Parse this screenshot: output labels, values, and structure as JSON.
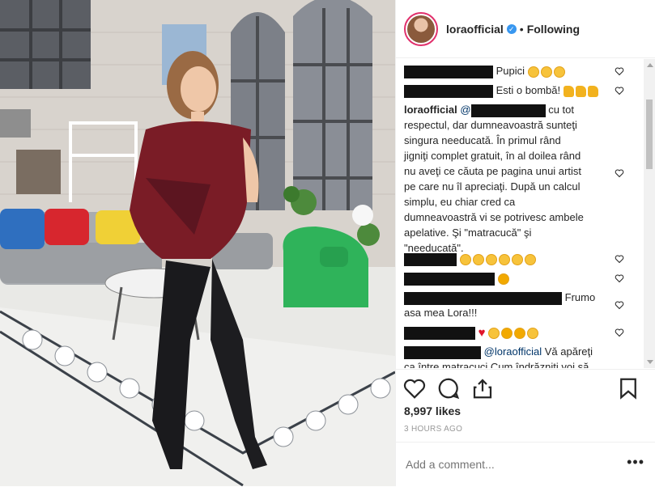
{
  "post": {
    "username": "loraofficial",
    "follow_status": "Following",
    "separator": "•",
    "likes": "8,997 likes",
    "time": "3 HOURS AGO",
    "add_comment_placeholder": "Add a comment...",
    "more_label": "•••"
  },
  "comments": [
    {
      "text": "Pupici"
    },
    {
      "text": "Esti o bombă!"
    },
    {
      "author": "loraofficial",
      "mention": "@",
      "text_lines": [
        "cu tot",
        "respectul, dar dumneavoastră sunteţi",
        "singura needucată. În primul rând",
        "jigniţi complet gratuit, în al doilea rând",
        "nu aveţi ce căuta pe pagina unui artist",
        "pe care nu îl apreciaţi. După un calcul",
        "simplu, eu chiar cred ca",
        "dumneavoastră vi se potrivesc ambele",
        "apelative. Şi \"matracucă\" şi",
        "\"needucată\"."
      ]
    },
    {
      "text": ""
    },
    {
      "text": ""
    },
    {
      "text_lines": [
        "Frumo",
        "asa mea Lora!!!"
      ]
    },
    {
      "text": ""
    },
    {
      "mention": "@loraofficial",
      "text_lines": [
        "Vă apăreţi",
        "ca între matracuci Cum îndrăzniţi voi să"
      ]
    }
  ],
  "colors": {
    "accent": "#3897f0",
    "heart_red": "#e0142b",
    "text": "#262626",
    "muted": "#999999"
  },
  "icons": [
    "heart-icon",
    "comment-icon",
    "share-icon",
    "bookmark-icon",
    "verified-icon"
  ]
}
